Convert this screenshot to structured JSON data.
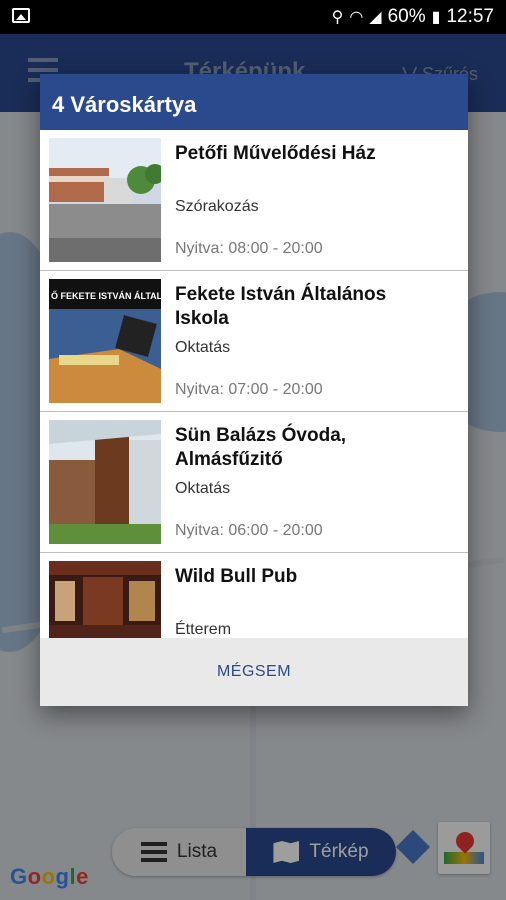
{
  "status_bar": {
    "battery": "60%",
    "time": "12:57"
  },
  "app_bar": {
    "title": "Térképünk",
    "filter_label": "Szűrés"
  },
  "dialog": {
    "title": "4 Városkártya",
    "items": [
      {
        "title": "Petőfi Művelődési Ház",
        "category": "Szórakozás",
        "hours": "Nyitva: 08:00 - 20:00"
      },
      {
        "title": "Fekete István Általános Iskola",
        "category": "Oktatás",
        "hours": "Nyitva: 07:00 - 20:00",
        "thumb_caption": "Ő FEKETE ISTVÁN ÁLTALÁ"
      },
      {
        "title": "Sün Balázs Óvoda, Almásfűzitő",
        "category": "Oktatás",
        "hours": "Nyitva: 06:00 - 20:00"
      },
      {
        "title": "Wild Bull Pub",
        "category": "Étterem",
        "hours": ""
      }
    ],
    "cancel_label": "MÉGSEM"
  },
  "bottom_bar": {
    "list_label": "Lista",
    "map_label": "Térkép"
  },
  "map": {
    "attribution": "Google"
  },
  "colors": {
    "primary": "#2b4a8e",
    "cancel_text": "#2b4a8e"
  }
}
